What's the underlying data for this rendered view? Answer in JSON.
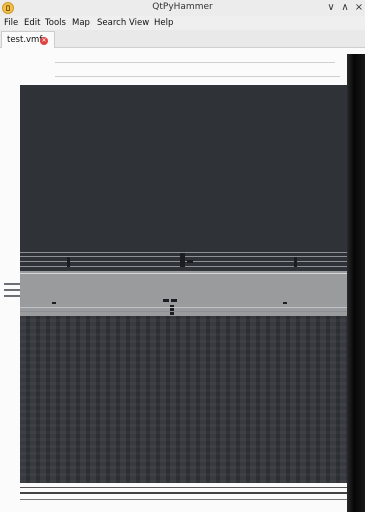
{
  "window": {
    "title": "QtPyHammer",
    "minimize_glyph": "∨",
    "maximize_glyph": "∧",
    "close_glyph": "×",
    "app_icon": "qtpyhammer-logo-icon"
  },
  "menu": {
    "items": [
      {
        "label": "File"
      },
      {
        "label": "Edit"
      },
      {
        "label": "Tools"
      },
      {
        "label": "Map"
      },
      {
        "label": "Search"
      },
      {
        "label": "View"
      },
      {
        "label": "Help"
      }
    ]
  },
  "tabs": [
    {
      "label": "test.vmf",
      "close_icon": "close-icon",
      "close_color": "#e0413f"
    }
  ],
  "viewport": {
    "background": "#2f3237",
    "band_color": "#9a9b9d"
  }
}
